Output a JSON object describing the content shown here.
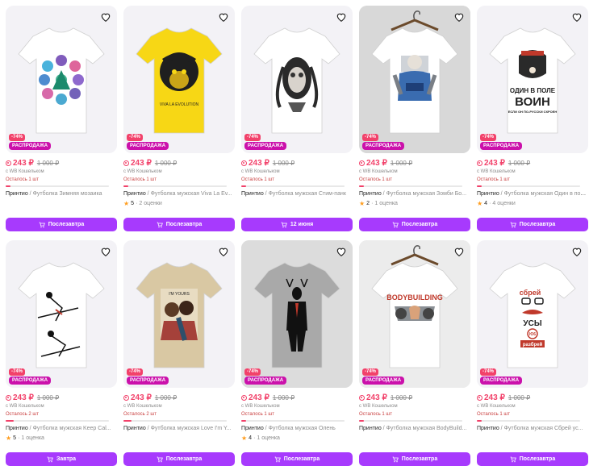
{
  "colors": {
    "accent": "#a73afd",
    "price": "#f2416a",
    "sale": "#cb11ab"
  },
  "products": [
    {
      "discount": "-74%",
      "sale": "РАСПРОДАЖА",
      "price": "243 ₽",
      "old_price": "1 000 ₽",
      "wallet": "с WB Кошельком",
      "left": "Осталось 1 шт",
      "stock_level": 0.05,
      "brand": "Принтио",
      "sep": " / ",
      "name": "Футболка Зимняя мозаика",
      "rating": "",
      "reviews": "",
      "button": "Послезавтра",
      "art": "mosaic"
    },
    {
      "discount": "-74%",
      "sale": "РАСПРОДАЖА",
      "price": "243 ₽",
      "old_price": "1 000 ₽",
      "wallet": "с WB Кошельком",
      "left": "Осталось 1 шт",
      "stock_level": 0.05,
      "brand": "Принтио",
      "sep": " / ",
      "name": "Футболка мужская Viva La Ev...",
      "rating": "5",
      "reviews": "2 оценки",
      "button": "Послезавтра",
      "art": "monkey",
      "print_text": "VIVA LA EVOLUTION"
    },
    {
      "discount": "-74%",
      "sale": "РАСПРОДАЖА",
      "price": "243 ₽",
      "old_price": "1 000 ₽",
      "wallet": "с WB Кошельком",
      "left": "Осталось 1 шт",
      "stock_level": 0.05,
      "brand": "Принтио",
      "sep": " / ",
      "name": "Футболка мужская Стим-панк",
      "rating": "",
      "reviews": "",
      "button": "12 июня",
      "art": "steampunk"
    },
    {
      "discount": "-74%",
      "sale": "РАСПРОДАЖА",
      "price": "243 ₽",
      "old_price": "1 000 ₽",
      "wallet": "с WB Кошельком",
      "left": "Осталось 1 шт",
      "stock_level": 0.05,
      "brand": "Принтио",
      "sep": " / ",
      "name": "Футболка мужская Зомби Бо...",
      "rating": "2",
      "reviews": "1 оценка",
      "button": "Послезавтра",
      "art": "zombie"
    },
    {
      "discount": "-74%",
      "sale": "РАСПРОДАЖА",
      "price": "243 ₽",
      "old_price": "1 000 ₽",
      "wallet": "с WB Кошельком",
      "left": "Осталось 1 шт",
      "stock_level": 0.05,
      "brand": "Принтио",
      "sep": " / ",
      "name": "Футболка мужская Один в поле...",
      "rating": "4",
      "reviews": "4 оценки",
      "button": "Послезавтра",
      "art": "bear",
      "print_line1": "ОДИН В ПОЛЕ",
      "print_line2": "ВОИН",
      "print_line3": "ЕСЛИ ОН ПО-РУССКИ СКРОЕН"
    },
    {
      "discount": "-74%",
      "sale": "РАСПРОДАЖА",
      "price": "243 ₽",
      "old_price": "1 000 ₽",
      "wallet": "с WB Кошельком",
      "left": "Осталось 2 шт",
      "stock_level": 0.08,
      "brand": "Принтио",
      "sep": " / ",
      "name": "Футболка мужская Keep Cal...",
      "rating": "5",
      "reviews": "1 оценка",
      "button": "Завтра",
      "art": "skiers"
    },
    {
      "discount": "-74%",
      "sale": "РАСПРОДАЖА",
      "price": "243 ₽",
      "old_price": "1 000 ₽",
      "wallet": "с WB Кошельком",
      "left": "Осталось 2 шт",
      "stock_level": 0.08,
      "brand": "Принтио",
      "sep": " / ",
      "name": "Футболка мужская Love I'm Y...",
      "rating": "",
      "reviews": "",
      "button": "Послезавтра",
      "art": "kiss",
      "print_text": "I'M YOURS"
    },
    {
      "discount": "-74%",
      "sale": "РАСПРОДАЖА",
      "price": "243 ₽",
      "old_price": "1 000 ₽",
      "wallet": "с WB Кошельком",
      "left": "Осталось 1 шт",
      "stock_level": 0.05,
      "brand": "Принтио",
      "sep": " / ",
      "name": "Футболка мужская Олень",
      "rating": "4",
      "reviews": "1 оценка",
      "button": "Послезавтра",
      "art": "deer"
    },
    {
      "discount": "-74%",
      "sale": "РАСПРОДАЖА",
      "price": "243 ₽",
      "old_price": "1 000 ₽",
      "wallet": "с WB Кошельком",
      "left": "Осталось 1 шт",
      "stock_level": 0.05,
      "brand": "Принтио",
      "sep": " / ",
      "name": "Футболка мужская BodyBuild...",
      "rating": "",
      "reviews": "",
      "button": "Послезавтра",
      "art": "bodybuilding",
      "print_text": "BODYBUILDING"
    },
    {
      "discount": "-74%",
      "sale": "РАСПРОДАЖА",
      "price": "243 ₽",
      "old_price": "1 000 ₽",
      "wallet": "с WB Кошельком",
      "left": "Осталось 1 шт",
      "stock_level": 0.05,
      "brand": "Принтио",
      "sep": " / ",
      "name": "Футболка мужская Сбрей ус...",
      "rating": "",
      "reviews": "",
      "button": "Послезавтра",
      "art": "mustache",
      "print_line1": "сбрей",
      "print_line2": "УСЫ",
      "print_line3": "разбрей",
      "print_badge": "Ю6"
    }
  ]
}
